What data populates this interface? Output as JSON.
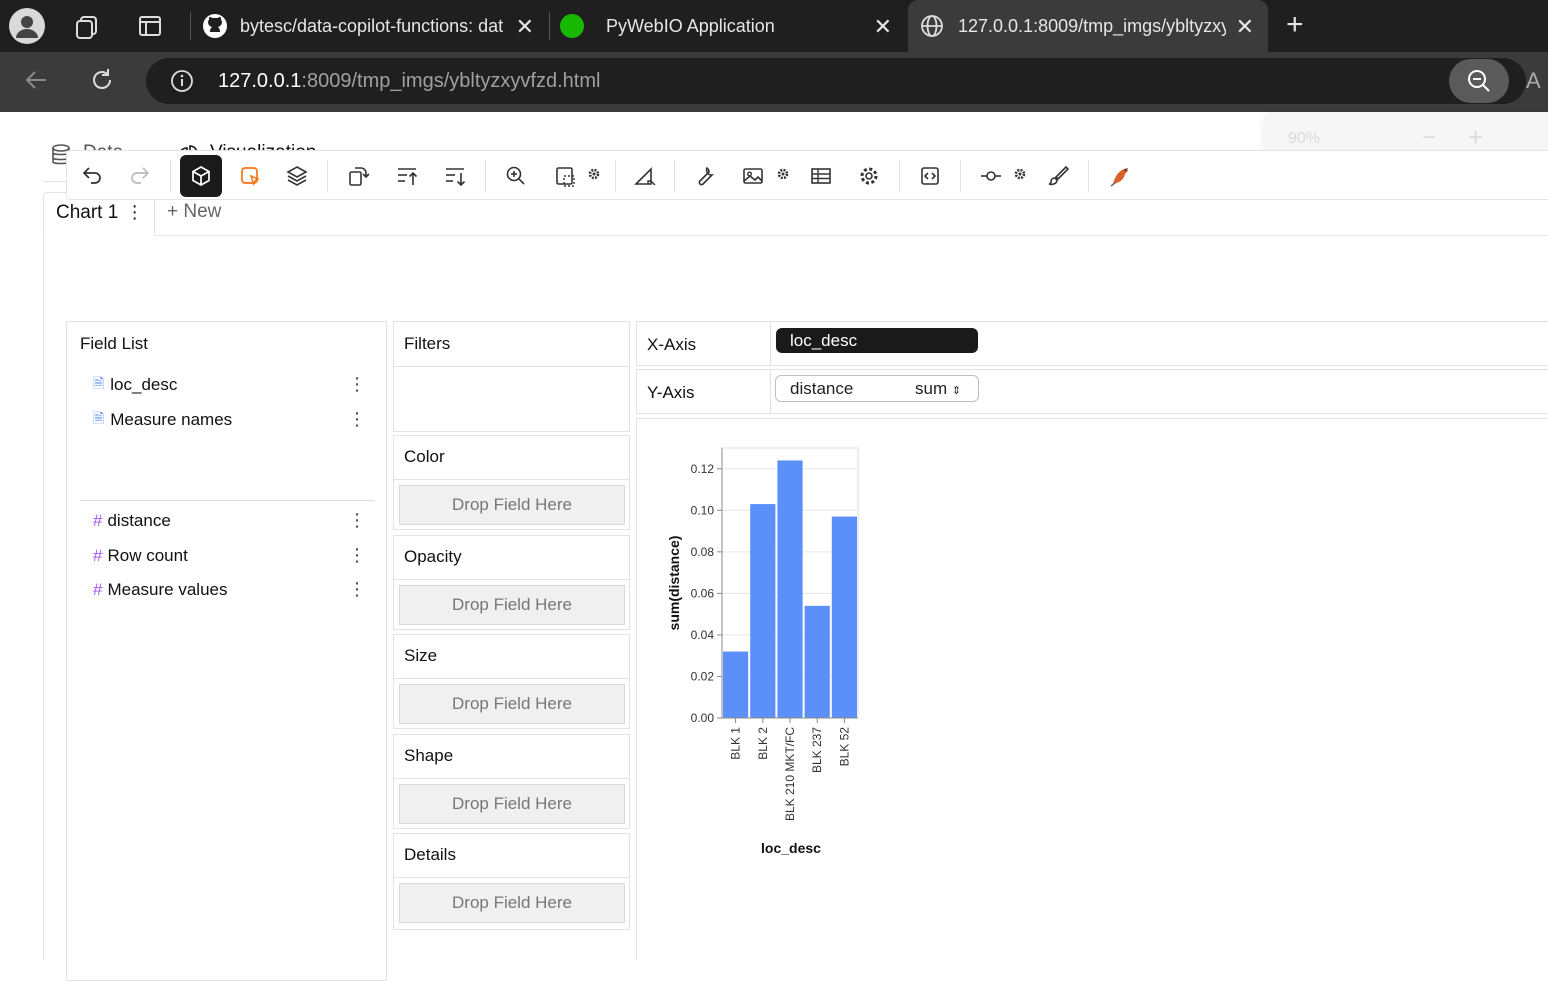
{
  "browser": {
    "tabs": [
      {
        "title": "bytesc/data-copilot-functions: dat"
      },
      {
        "title": "PyWebIO Application"
      },
      {
        "title": "127.0.0.1:8009/tmp_imgs/ybltyzxy"
      }
    ],
    "url_host": "127.0.0.1",
    "url_rest": ":8009/tmp_imgs/ybltyzxyvfzd.html",
    "zoom_label": "90%",
    "reader_label": "A"
  },
  "nav_tabs": [
    {
      "label": "Data"
    },
    {
      "label": "Visualization"
    }
  ],
  "chart_tabs": {
    "active": "Chart 1",
    "new": "+ New"
  },
  "field_list": {
    "title": "Field List",
    "dimensions": [
      "loc_desc",
      "Measure names"
    ],
    "measures": [
      "distance",
      "Row count",
      "Measure values"
    ]
  },
  "filters_title": "Filters",
  "encodings": [
    {
      "label": "Color",
      "drop": "Drop Field Here"
    },
    {
      "label": "Opacity",
      "drop": "Drop Field Here"
    },
    {
      "label": "Size",
      "drop": "Drop Field Here"
    },
    {
      "label": "Shape",
      "drop": "Drop Field Here"
    },
    {
      "label": "Details",
      "drop": "Drop Field Here"
    }
  ],
  "axes": {
    "x_label": "X-Axis",
    "x_field": "loc_desc",
    "y_label": "Y-Axis",
    "y_field": "distance",
    "y_agg": "sum"
  },
  "colors": {
    "bar": "#5b8ff9",
    "accent": "#f97316",
    "active_button": "#1a1a1a"
  },
  "chart_data": {
    "type": "bar",
    "categories": [
      "BLK 1",
      "BLK 2",
      "BLK 210 MKT/FC",
      "BLK 237",
      "BLK 52"
    ],
    "values": [
      0.032,
      0.103,
      0.124,
      0.054,
      0.097
    ],
    "xlabel": "loc_desc",
    "ylabel": "sum(distance)",
    "ylim": [
      0,
      0.13
    ],
    "yticks": [
      "0.00",
      "0.02",
      "0.04",
      "0.06",
      "0.08",
      "0.10",
      "0.12"
    ],
    "grid": true
  }
}
